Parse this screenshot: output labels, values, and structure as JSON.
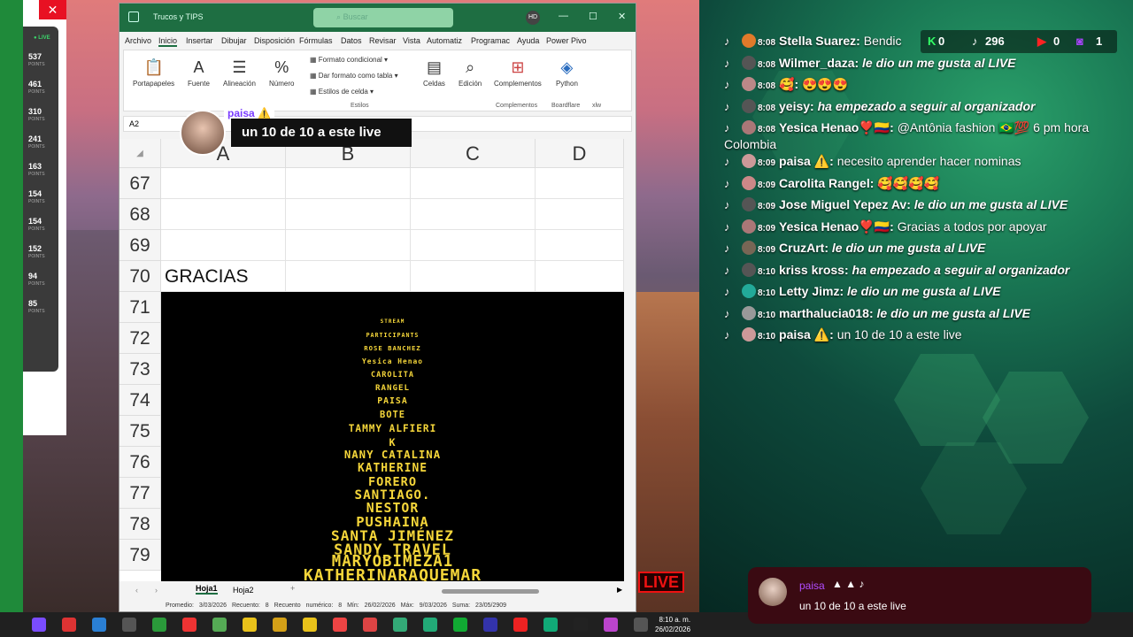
{
  "left_panel": {
    "live_label": "LIVE",
    "points": [
      {
        "value": "537",
        "label": "POINTS"
      },
      {
        "value": "461",
        "label": "POINTS"
      },
      {
        "value": "310",
        "label": "POINTS"
      },
      {
        "value": "241",
        "label": "POINTS"
      },
      {
        "value": "163",
        "label": "POINTS"
      },
      {
        "value": "154",
        "label": "POINTS"
      },
      {
        "value": "154",
        "label": "POINTS"
      },
      {
        "value": "152",
        "label": "POINTS"
      },
      {
        "value": "94",
        "label": "POINTS"
      },
      {
        "value": "85",
        "label": "POINTS"
      }
    ]
  },
  "excel": {
    "doc_title": "Trucos y TIPS",
    "search_placeholder": "Buscar",
    "user_initials": "HD",
    "tabs": [
      "Archivo",
      "Inicio",
      "Insertar",
      "Dibujar",
      "Disposición",
      "Fórmulas",
      "Datos",
      "Revisar",
      "Vista",
      "Automatiz",
      "Programac",
      "Ayuda",
      "Power Pivo"
    ],
    "ribbon": {
      "portapapeles": "Portapapeles",
      "fuente": "Fuente",
      "alineacion": "Alineación",
      "numero": "Número",
      "formato_condicional": "Formato condicional",
      "dar_formato_tabla": "Dar formato como tabla",
      "estilos_celda": "Estilos de celda",
      "estilos_group": "Estilos",
      "celdas": "Celdas",
      "edicion": "Edición",
      "complementos": "Complementos",
      "complementos_group": "Complementos",
      "python": "Python",
      "boardflare": "Boardflare",
      "xlw": "xlw"
    },
    "name_box": "A2",
    "columns": [
      "A",
      "B",
      "C",
      "D"
    ],
    "rows": [
      "67",
      "68",
      "69",
      "70",
      "71",
      "72",
      "73",
      "74",
      "75",
      "76",
      "77",
      "78",
      "79"
    ],
    "cell_a70": "GRACIAS",
    "credits": [
      "STREAM",
      "PARTICIPANTS",
      "ROSE BANCHEZ",
      "Yesica Henao",
      "CAROLITA",
      "RANGEL",
      "PAISA",
      "BOTE",
      "TAMMY ALFIERI",
      "K",
      "NANY CATALINA",
      "KATHERINE",
      "FORERO",
      "SANTIAGO.",
      "NESTOR",
      "PUSHAINA",
      "SANTA JIMÉNEZ",
      "SANDY_TRAVEL",
      "MARYOBIMEZA1",
      "KATHERINARAQUEMAR"
    ],
    "sheets": [
      "Hoja1",
      "Hoja2"
    ],
    "status": {
      "promedio": "Promedio: 3/03/2026",
      "recuento": "Recuento: 8",
      "recuento_num": "Recuento numérico: 8",
      "min": "Mín: 26/02/2026",
      "max": "Máx: 9/03/2026",
      "suma": "Suma: 23/05/2909"
    }
  },
  "overlay": {
    "name": "paisa ⚠️",
    "message": "un 10 de 10 a este live"
  },
  "stream_stats": {
    "a": "0",
    "b": "296",
    "c": "0",
    "d": "1"
  },
  "chat": [
    {
      "time": "8:08",
      "name": "Stella Suarez:",
      "text": "Bendic",
      "style": "tx2",
      "avatar": "#e07a2a"
    },
    {
      "time": "8:08",
      "name": "Wilmer_daza:",
      "text": "le dio un me gusta al LIVE",
      "style": "tx",
      "avatar": "#555"
    },
    {
      "time": "8:08",
      "name": "🥰:",
      "text": "😍😍😍",
      "style": "tx2",
      "avatar": "#b88"
    },
    {
      "time": "8:08",
      "name": "yeisy:",
      "text": "ha empezado a seguir al organizador",
      "style": "tx",
      "avatar": "#555"
    },
    {
      "time": "8:08",
      "name": "Yesica Henao❣️🇨🇴:",
      "text": "@Antônia fashion 🇧🇷💯 6 pm hora Colombia",
      "style": "tx2",
      "avatar": "#a77"
    },
    {
      "time": "8:09",
      "name": "paisa ⚠️:",
      "text": "necesito aprender hacer nominas",
      "style": "tx2",
      "avatar": "#c99"
    },
    {
      "time": "8:09",
      "name": "Carolita Rangel:",
      "text": "🥰🥰🥰🥰",
      "style": "tx2",
      "avatar": "#c88"
    },
    {
      "time": "8:09",
      "name": "Jose Miguel Yepez Av:",
      "text": "le dio un me gusta al LIVE",
      "style": "tx",
      "avatar": "#555"
    },
    {
      "time": "8:09",
      "name": "Yesica Henao❣️🇨🇴:",
      "text": "Gracias a todos por apoyar",
      "style": "tx2",
      "avatar": "#a77"
    },
    {
      "time": "8:09",
      "name": "CruzArt:",
      "text": "le dio un me gusta al LIVE",
      "style": "tx",
      "avatar": "#765"
    },
    {
      "time": "8:10",
      "name": "kriss kross:",
      "text": "ha empezado a seguir al organizador",
      "style": "tx",
      "avatar": "#555"
    },
    {
      "time": "8:10",
      "name": "Letty Jimz:",
      "text": "le dio un me gusta al LIVE",
      "style": "tx",
      "avatar": "#2a9"
    },
    {
      "time": "8:10",
      "name": "marthalucia018:",
      "text": "le dio un me gusta al LIVE",
      "style": "tx",
      "avatar": "#999"
    },
    {
      "time": "8:10",
      "name": "paisa ⚠️:",
      "text": "un 10 de 10 a este live",
      "style": "tx2",
      "avatar": "#c99"
    }
  ],
  "toast": {
    "name": "paisa",
    "message": "un 10 de 10 a este live"
  },
  "live_badge": "LIVE",
  "clock": {
    "time": "8:10 a. m.",
    "date": "26/02/2026"
  }
}
